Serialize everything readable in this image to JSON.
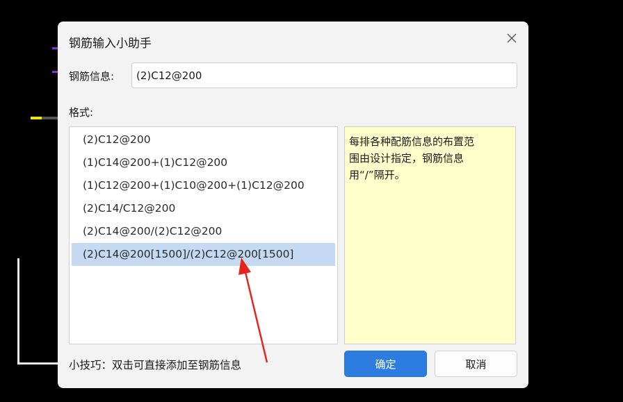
{
  "dialog": {
    "title": "钢筋输入小助手",
    "info_label": "钢筋信息:",
    "info_value": "(2)C12@200",
    "format_label": "格式:",
    "formats": [
      "(2)C12@200",
      "(1)C14@200+(1)C12@200",
      "(1)C12@200+(1)C10@200+(1)C12@200",
      "(2)C14/C12@200",
      "(2)C14@200/(2)C12@200",
      "(2)C14@200[1500]/(2)C12@200[1500]"
    ],
    "selected_format_index": 5,
    "hint_lines": [
      "每排各种配筋信息的布置范",
      "围由设计指定，钢筋信息",
      "用“/”隔开。"
    ],
    "tip": "小技巧：双击可直接添加至钢筋信息",
    "ok_label": "确定",
    "cancel_label": "取消"
  },
  "icons": {
    "close": "close-icon",
    "annotation": "red-arrow-annotation"
  },
  "colors": {
    "primary_button": "#2d7de0",
    "selection": "#c5daf2",
    "hint_background": "#ffffcc",
    "annotation_arrow": "#e8231c"
  }
}
